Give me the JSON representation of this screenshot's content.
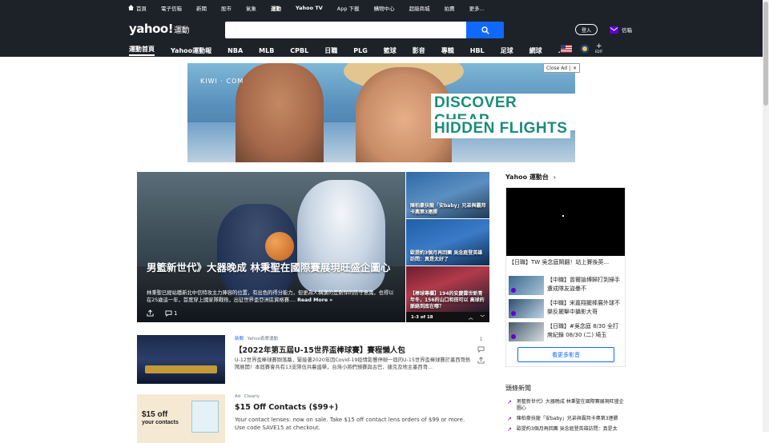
{
  "topnav": {
    "items": [
      "首頁",
      "電子信箱",
      "新聞",
      "股市",
      "氣象",
      "運動",
      "Yahoo TV",
      "App 下載",
      "購物中心",
      "超級商城",
      "拍賣",
      "更多..."
    ],
    "active_index": 5
  },
  "header": {
    "logo": "yahoo!",
    "logo_sub": "運動",
    "search_placeholder": "",
    "login_label": "登入",
    "mail_label": "信箱"
  },
  "subnav": {
    "items": [
      "運動首頁",
      "Yahoo運動報",
      "NBA",
      "MLB",
      "CPBL",
      "日職",
      "PLG",
      "籃球",
      "影音",
      "專輯",
      "HBL",
      "足球",
      "網球",
      "..."
    ],
    "edit_label": "EDIT"
  },
  "ad_banner": {
    "brand": "KIWI · COM",
    "line1": "DISCOVER CHEAP",
    "line2": "HIDDEN FLIGHTS",
    "close_label": "Close Ad",
    "close_x": "✕"
  },
  "hero": {
    "title": "男籃新世代》大器晚成 林秉聖在國際賽展現旺盛企圖心",
    "desc": "林秉聖已經站穩新北中信特攻主力陣容的位置，有出色的得分能力，但更為人稱讚的是剽悍的防守意識，也得以在25歲這一年，首度穿上國家隊戰袍，出征世界盃亞洲區資格賽....",
    "read_more": "Read More »",
    "comment_count": "1"
  },
  "side_stories": [
    {
      "caption": "陳柏豪扶龍「安baby」兄弟與霸邦卡奧第3連勝"
    },
    {
      "caption": "歐提約3個月再回團 吳念庭登英雄訪問：真是太好了"
    },
    {
      "caption": "【棒球專欄】194的安慶霖世新青年冬，156的山口和田可以 高球的脈絡到底在哪？"
    }
  ],
  "pager": {
    "label": "1-3 of 18"
  },
  "yahoo_tv": {
    "title": "Yahoo 運動台",
    "now_playing": "【日職】TW 吳念庭鬧翻！站上賽後英...",
    "videos": [
      "【中職】曾爾諭博歸打到掃手遭成隊友盜壘不",
      "【中職】宋嘉翔擺棒展外球不樂反擺擊中攝影大哥",
      "【日職】#吳念庭 8/30 全打席紀錄 08/30 (二) 埼玉"
    ],
    "more_label": "看更多影音"
  },
  "headlines": {
    "title": "頭條新聞",
    "items": [
      "男籃新世代》大器晚成 林秉聖在國際賽展現旺盛企圖心",
      "陳柏豪扶龍「安baby」兄弟與霸邦卡奧第3連勝",
      "歐提約3個月再回團 吳念庭登英雄訪問：真是太"
    ]
  },
  "stories": [
    {
      "source": "新聞",
      "provider": "Yahoo奇摩運動",
      "headline": "【2022年第五屆U-15世界盃棒球賽】賽程懶人包",
      "body": "U-12世界盃棒球賽剛落幕，緊接著2020年因Covid-19疫情影響停辦一屆的U-15世界盃棒球賽於墨西哥熱鬧展開！本屆賽會共有13支隊伍共襄盛舉，台灣小將們預賽與古巴、捷克及地主墨西哥...",
      "comments": "1"
    },
    {
      "source": "Ad",
      "provider": "Clearly",
      "headline": "$15 Off Contacts ($99+)",
      "body": "Your contact lenses: now on sale. Take $15 off contact lens orders of $99 or more. Use code SAVE15 at checkout.",
      "thumb_text1": "$15 off",
      "thumb_text2": "your contacts"
    }
  ],
  "colors": {
    "nav_bg": "#1d2228",
    "search_blue": "#0f69ff",
    "yahoo_purple": "#6001d2"
  }
}
